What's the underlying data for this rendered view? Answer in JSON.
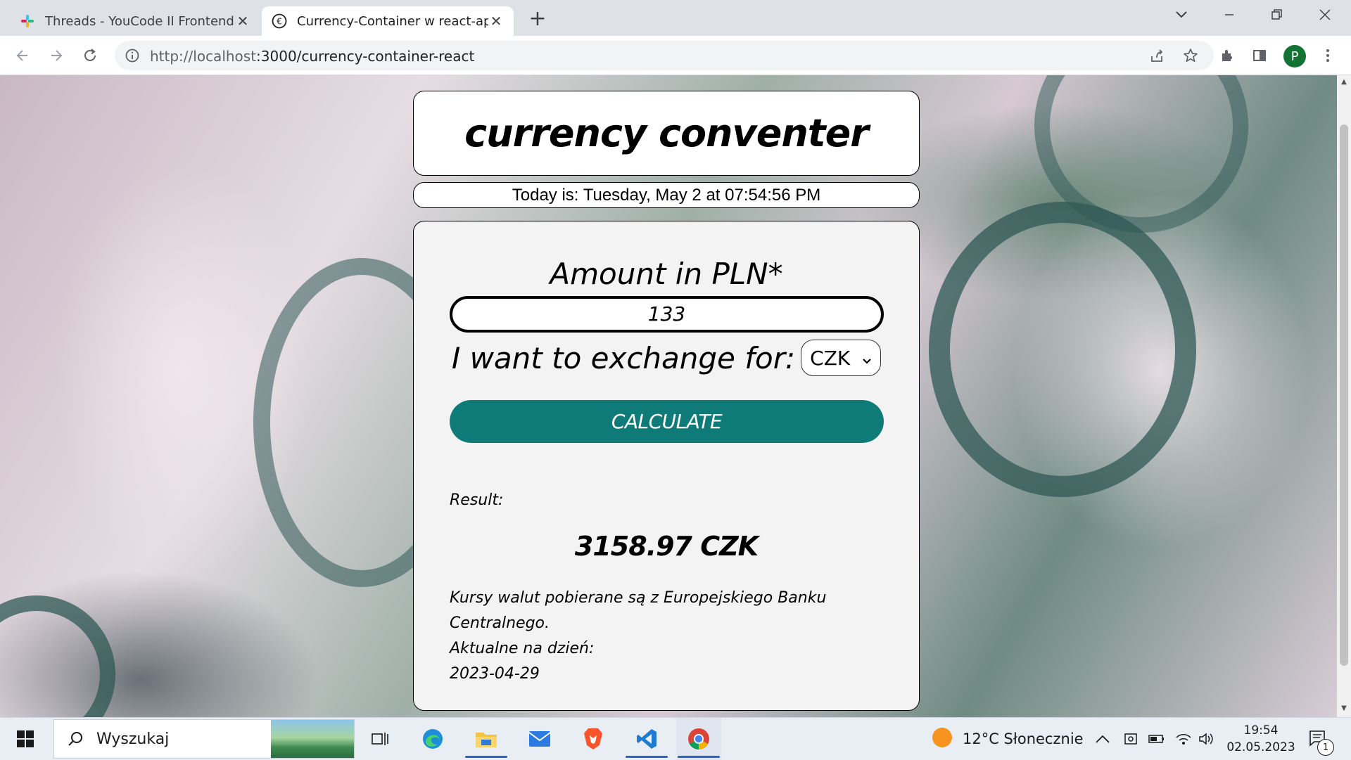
{
  "browser": {
    "tabs": [
      {
        "title": "Threads - YouCode II Frontend D",
        "active": false,
        "favicon": "slack-icon"
      },
      {
        "title": "Currency-Container w react-app",
        "active": true,
        "favicon": "euro-icon"
      }
    ],
    "url_host": "http://localhost",
    "url_path": ":3000/currency-container-react",
    "profile_initial": "P"
  },
  "app": {
    "title": "currency conventer",
    "date_text": "Today is: Tuesday, May 2 at 07:54:56 PM",
    "amount_label": "Amount in PLN*",
    "amount_value": "133",
    "exchange_label": "I want to exchange for:",
    "currency_selected": "CZK",
    "calculate_label": "CALCULATE",
    "result_label": "Result:",
    "result_value": "3158.97 CZK",
    "note_line1": "Kursy walut pobierane są z Europejskiego Banku Centralnego.",
    "note_line2": "Aktualne na dzień:",
    "note_date": "2023-04-29",
    "accent_color": "#0f7b78"
  },
  "taskbar": {
    "search_placeholder": "Wyszukaj",
    "weather": "12°C  Słonecznie",
    "time": "19:54",
    "date": "02.05.2023",
    "notification_count": "1"
  }
}
